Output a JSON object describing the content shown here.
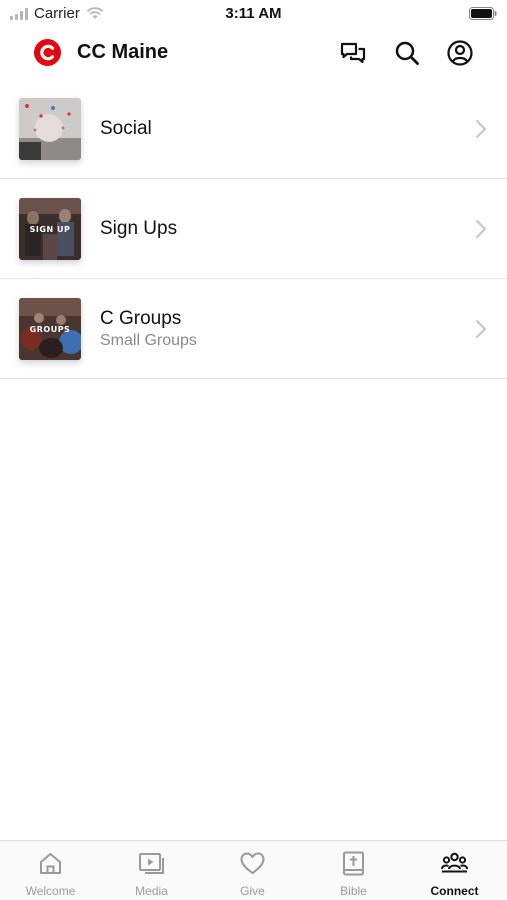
{
  "status_bar": {
    "carrier": "Carrier",
    "time": "3:11 AM"
  },
  "header": {
    "title": "CC Maine",
    "brand_color": "#e30613",
    "icons": [
      "chat-icon",
      "search-icon",
      "account-icon"
    ]
  },
  "list": {
    "items": [
      {
        "title": "Social",
        "subtitle": "",
        "thumb_label": "",
        "icon": "chevron-right-icon"
      },
      {
        "title": "Sign Ups",
        "subtitle": "",
        "thumb_label": "SIGN UP",
        "icon": "chevron-right-icon"
      },
      {
        "title": "C Groups",
        "subtitle": "Small Groups",
        "thumb_label": "GROUPS",
        "icon": "chevron-right-icon"
      }
    ]
  },
  "tabbar": {
    "tabs": [
      {
        "label": "Welcome",
        "icon": "home-icon",
        "active": false
      },
      {
        "label": "Media",
        "icon": "media-icon",
        "active": false
      },
      {
        "label": "Give",
        "icon": "heart-icon",
        "active": false
      },
      {
        "label": "Bible",
        "icon": "bible-icon",
        "active": false
      },
      {
        "label": "Connect",
        "icon": "people-icon",
        "active": true
      }
    ]
  }
}
